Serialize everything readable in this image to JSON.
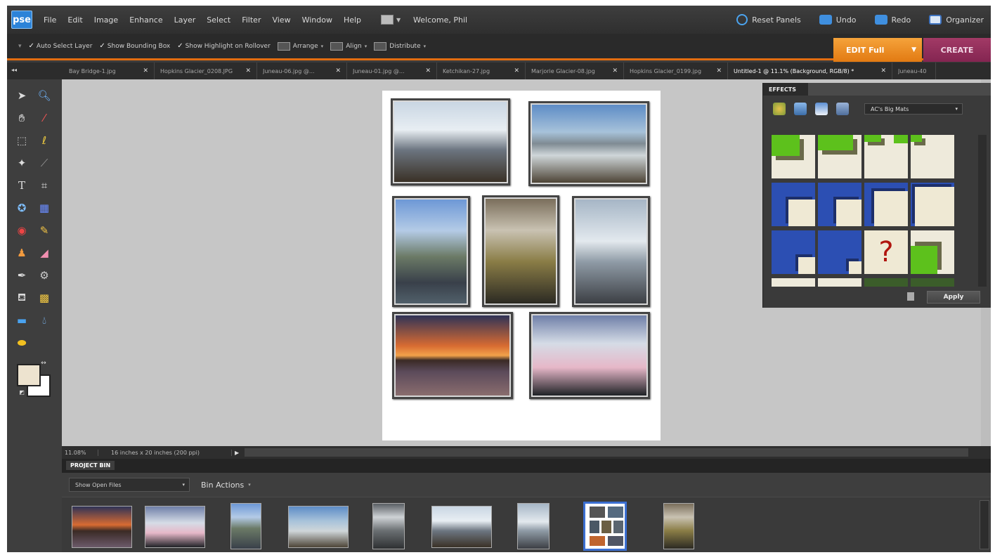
{
  "app": {
    "logo": "pse",
    "menu": [
      "File",
      "Edit",
      "Image",
      "Enhance",
      "Layer",
      "Select",
      "Filter",
      "View",
      "Window",
      "Help"
    ],
    "welcome": "Welcome, Phil",
    "right": {
      "reset": "Reset Panels",
      "undo": "Undo",
      "redo": "Redo",
      "organizer": "Organizer"
    }
  },
  "options": {
    "auto_select": "Auto Select Layer",
    "bounding_box": "Show Bounding Box",
    "highlight": "Show Highlight on Rollover",
    "arrange": "Arrange",
    "align": "Align",
    "distribute": "Distribute",
    "edit_full": "EDIT Full",
    "create": "CREATE"
  },
  "tabs": [
    {
      "label": "Bay Bridge-1.jpg",
      "active": false
    },
    {
      "label": "Hopkins Glacier_0208.JPG",
      "active": false
    },
    {
      "label": "Juneau-06.jpg @...",
      "active": false
    },
    {
      "label": "Juneau-01.jpg @...",
      "active": false
    },
    {
      "label": "Ketchikan-27.jpg",
      "active": false
    },
    {
      "label": "Marjorie Glacier-08.jpg",
      "active": false
    },
    {
      "label": "Hopkins Glacier_0199.jpg",
      "active": false
    },
    {
      "label": "Untitled-1 @ 11.1% (Background, RGB/8) *",
      "active": true
    },
    {
      "label": "Juneau-40",
      "active": false
    }
  ],
  "effects": {
    "title": "EFFECTS",
    "filter": "AC's Big Mats",
    "apply": "Apply"
  },
  "status": {
    "zoom": "11.08%",
    "size": "16 inches x 20 inches (200 ppi)"
  },
  "bin": {
    "title": "PROJECT BIN",
    "show": "Show Open Files",
    "actions": "Bin Actions"
  }
}
